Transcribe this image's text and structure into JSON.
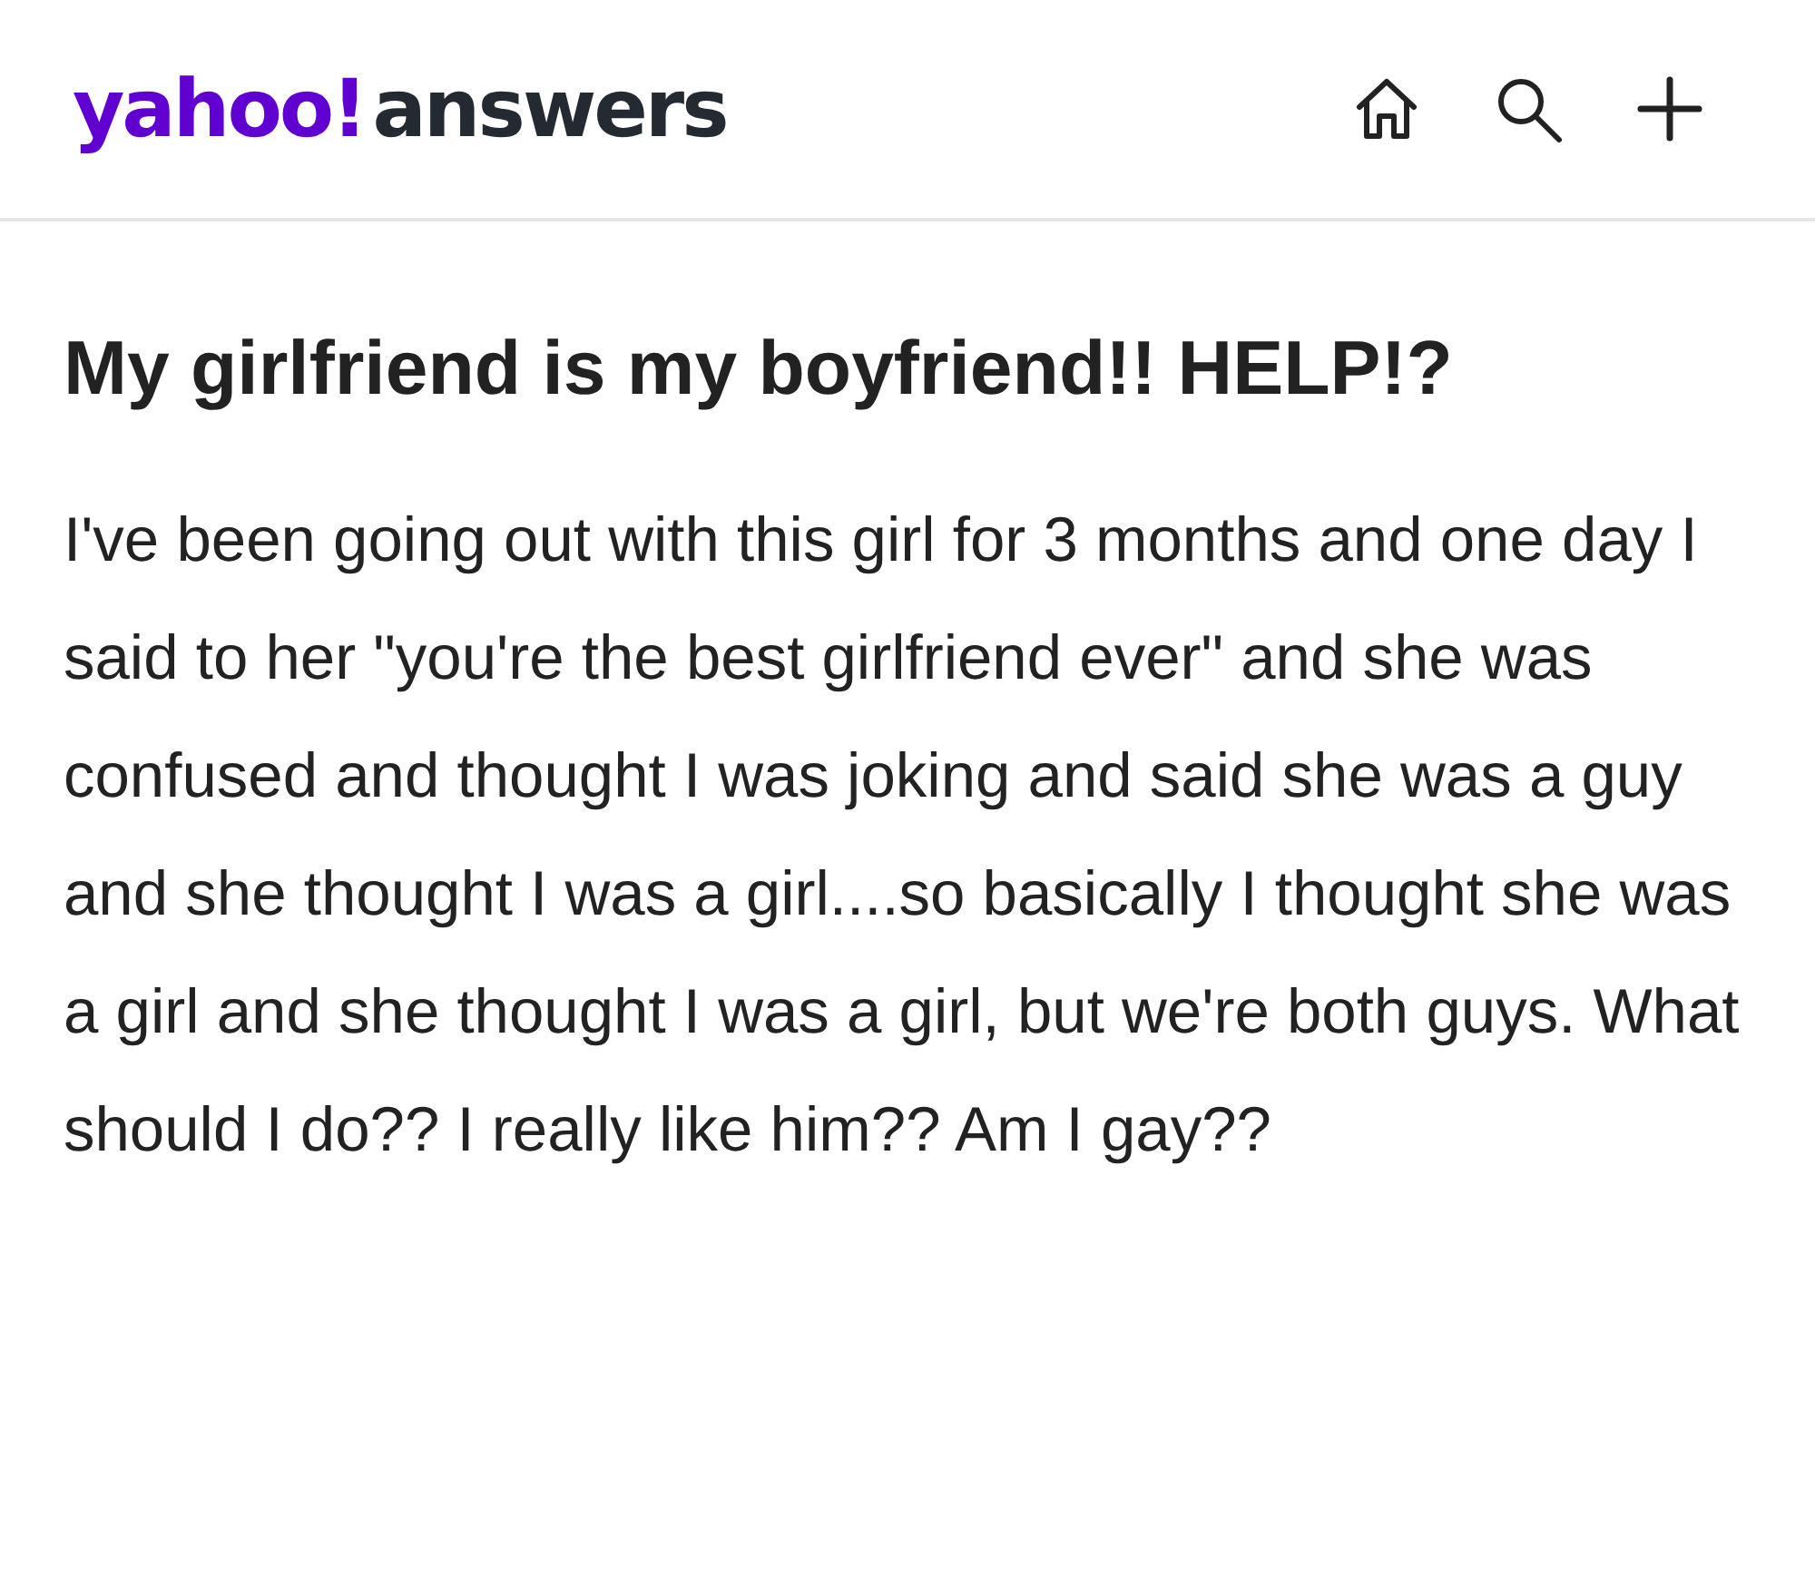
{
  "header": {
    "logo": {
      "brand": "yahoo!",
      "product": "answers"
    },
    "actions": [
      {
        "kind": "home"
      },
      {
        "kind": "search"
      },
      {
        "kind": "add"
      }
    ]
  },
  "question": {
    "title": "My girlfriend is my boyfriend!! HELP!?",
    "body": "I've been going out with this girl for 3 months and one day I said to her \"you're the best girlfriend ever\" and she was confused and thought I was joking and said she was a guy and she thought I was a girl....so basically I thought she was a girl and she thought I was a girl, but we're both guys. What should I do?? I really like him?? Am I gay??"
  }
}
